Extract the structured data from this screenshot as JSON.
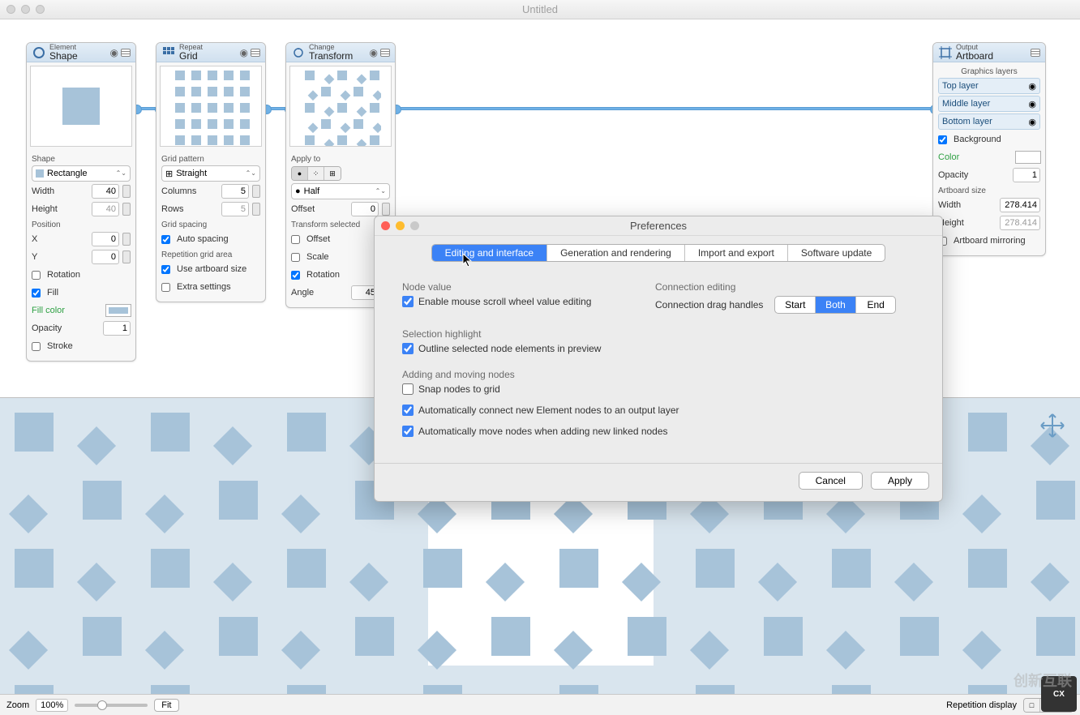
{
  "window": {
    "title": "Untitled"
  },
  "nodes": {
    "shape": {
      "category": "Element",
      "title": "Shape",
      "shape_label": "Shape",
      "shape_value": "Rectangle",
      "width_label": "Width",
      "width_value": "40",
      "height_label": "Height",
      "height_value": "40",
      "position_label": "Position",
      "x_label": "X",
      "x_value": "0",
      "y_label": "Y",
      "y_value": "0",
      "rotation_label": "Rotation",
      "fill_label": "Fill",
      "fillcolor_label": "Fill color",
      "opacity_label": "Opacity",
      "opacity_value": "1",
      "stroke_label": "Stroke",
      "fill_swatch": "#a7c3d9"
    },
    "grid": {
      "category": "Repeat",
      "title": "Grid",
      "pattern_label": "Grid pattern",
      "pattern_value": "Straight",
      "columns_label": "Columns",
      "columns_value": "5",
      "rows_label": "Rows",
      "rows_value": "5",
      "spacing_label": "Grid spacing",
      "autospacing_label": "Auto spacing",
      "area_label": "Repetition grid area",
      "useartboard_label": "Use artboard size",
      "extra_label": "Extra settings"
    },
    "transform": {
      "category": "Change",
      "title": "Transform",
      "applyto_label": "Apply to",
      "applyto_value": "Half",
      "offset_label": "Offset",
      "offset_value": "0",
      "tx_label": "Transform selected",
      "tx_offset": "Offset",
      "tx_scale": "Scale",
      "tx_rotation": "Rotation",
      "angle_label": "Angle",
      "angle_value": "45"
    },
    "artboard": {
      "category": "Output",
      "title": "Artboard",
      "layers_label": "Graphics layers",
      "top_layer": "Top layer",
      "middle_layer": "Middle layer",
      "bottom_layer": "Bottom layer",
      "background_label": "Background",
      "color_label": "Color",
      "opacity_label": "Opacity",
      "opacity_value": "1",
      "size_label": "Artboard size",
      "width_label": "Width",
      "width_value": "278.414",
      "height_label": "Height",
      "height_value": "278.414",
      "mirror_label": "Artboard mirroring",
      "color_swatch": "#ffffff"
    }
  },
  "prefs": {
    "title": "Preferences",
    "tabs": [
      "Editing and interface",
      "Generation and rendering",
      "Import and export",
      "Software update"
    ],
    "node_value_h": "Node value",
    "scroll_label": "Enable mouse scroll wheel value editing",
    "conn_h": "Connection editing",
    "drag_label": "Connection drag handles",
    "drag_options": [
      "Start",
      "Both",
      "End"
    ],
    "sel_h": "Selection highlight",
    "outline_label": "Outline selected node elements in preview",
    "adding_h": "Adding and moving nodes",
    "snap_label": "Snap nodes to grid",
    "autoconnect_label": "Automatically connect new Element nodes to an output layer",
    "automove_label": "Automatically move nodes when adding new linked nodes",
    "cancel": "Cancel",
    "apply": "Apply"
  },
  "statusbar": {
    "zoom_label": "Zoom",
    "zoom_value": "100%",
    "fit_label": "Fit",
    "rep_label": "Repetition display"
  },
  "watermark": "创新互联"
}
